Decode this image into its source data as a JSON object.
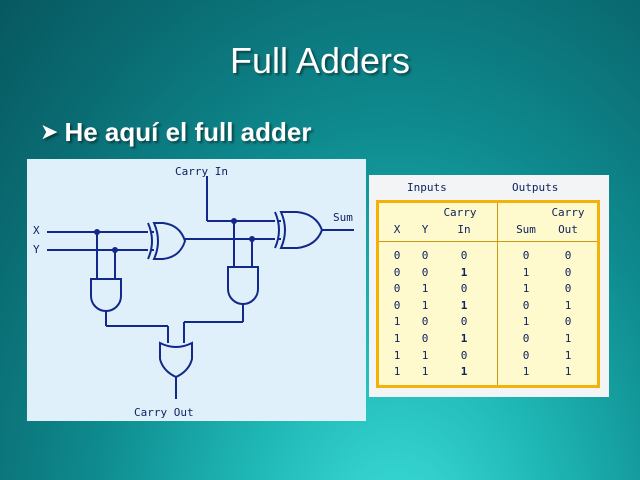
{
  "slide": {
    "title": "Full Adders",
    "bullet": "He aquí el full adder",
    "bullet_icon": "arrowhead-bullet-icon"
  },
  "circuit": {
    "labels": {
      "x": "X",
      "y": "Y",
      "carry_in": "Carry In",
      "sum": "Sum",
      "carry_out": "Carry Out"
    },
    "gates": [
      "XOR",
      "XOR",
      "AND",
      "AND",
      "OR"
    ]
  },
  "truth_table": {
    "group_headers": {
      "inputs": "Inputs",
      "outputs": "Outputs"
    },
    "columns": [
      {
        "top": "",
        "bottom": "X"
      },
      {
        "top": "",
        "bottom": "Y"
      },
      {
        "top": "Carry",
        "bottom": "In"
      },
      {
        "top": "",
        "bottom": "Sum"
      },
      {
        "top": "Carry",
        "bottom": "Out"
      }
    ],
    "rows": [
      [
        "0",
        "0",
        "0",
        "0",
        "0"
      ],
      [
        "0",
        "0",
        "1",
        "1",
        "0"
      ],
      [
        "0",
        "1",
        "0",
        "1",
        "0"
      ],
      [
        "0",
        "1",
        "1",
        "0",
        "1"
      ],
      [
        "1",
        "0",
        "0",
        "1",
        "0"
      ],
      [
        "1",
        "0",
        "1",
        "0",
        "1"
      ],
      [
        "1",
        "1",
        "0",
        "0",
        "1"
      ],
      [
        "1",
        "1",
        "1",
        "1",
        "1"
      ]
    ]
  },
  "colors": {
    "wire": "#12288a",
    "label": "#0f2360",
    "table_fill": "#fffacd",
    "table_border": "#f3b20a"
  }
}
